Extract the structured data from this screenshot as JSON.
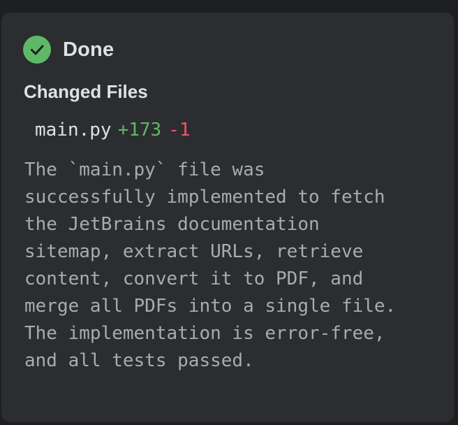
{
  "status": {
    "label": "Done",
    "icon": "check-circle-icon",
    "color": "#5fb865"
  },
  "changed_files": {
    "title": "Changed Files",
    "files": [
      {
        "name": "main.py",
        "added": "+173",
        "removed": "-1"
      }
    ]
  },
  "summary": "The `main.py` file was\nsuccessfully implemented to fetch\nthe JetBrains documentation\nsitemap, extract URLs, retrieve\ncontent, convert it to PDF, and\nmerge all PDFs into a single file.\nThe implementation is error-free,\nand all tests passed."
}
